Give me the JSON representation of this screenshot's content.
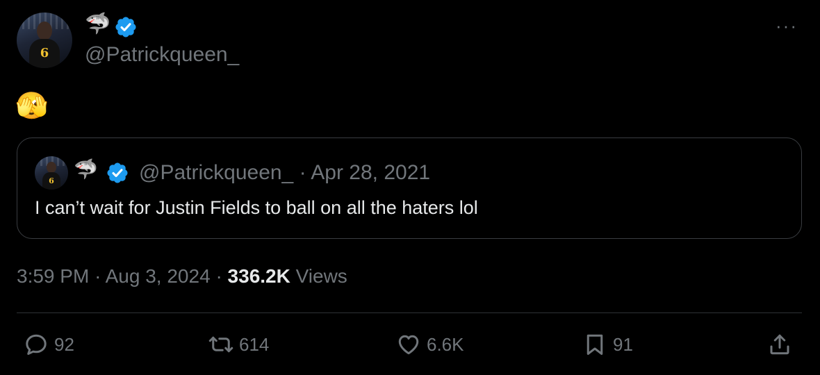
{
  "tweet": {
    "display_name_emoji": "🦈",
    "handle": "@Patrickqueen_",
    "more_label": "···",
    "body_emoji": "🫣",
    "time": "3:59 PM",
    "date": "Aug 3, 2024",
    "views_count": "336.2K",
    "views_label": "Views",
    "separator": "·"
  },
  "quoted": {
    "display_name_emoji": "🦈",
    "handle": "@Patrickqueen_",
    "date": "Apr 28, 2021",
    "text": "I can’t wait for Justin Fields to ball on all the haters lol",
    "separator": "·"
  },
  "avatar": {
    "jersey_number": "6"
  },
  "actions": {
    "replies": "92",
    "reposts": "614",
    "likes": "6.6K",
    "bookmarks": "91"
  },
  "colors": {
    "background": "#000000",
    "text": "#e7e9ea",
    "muted": "#71767b",
    "verified": "#1d9bf0",
    "border": "#2f3336"
  },
  "icons": [
    "verified-badge-icon",
    "more-icon",
    "reply-icon",
    "repost-icon",
    "like-icon",
    "bookmark-icon",
    "share-icon"
  ]
}
